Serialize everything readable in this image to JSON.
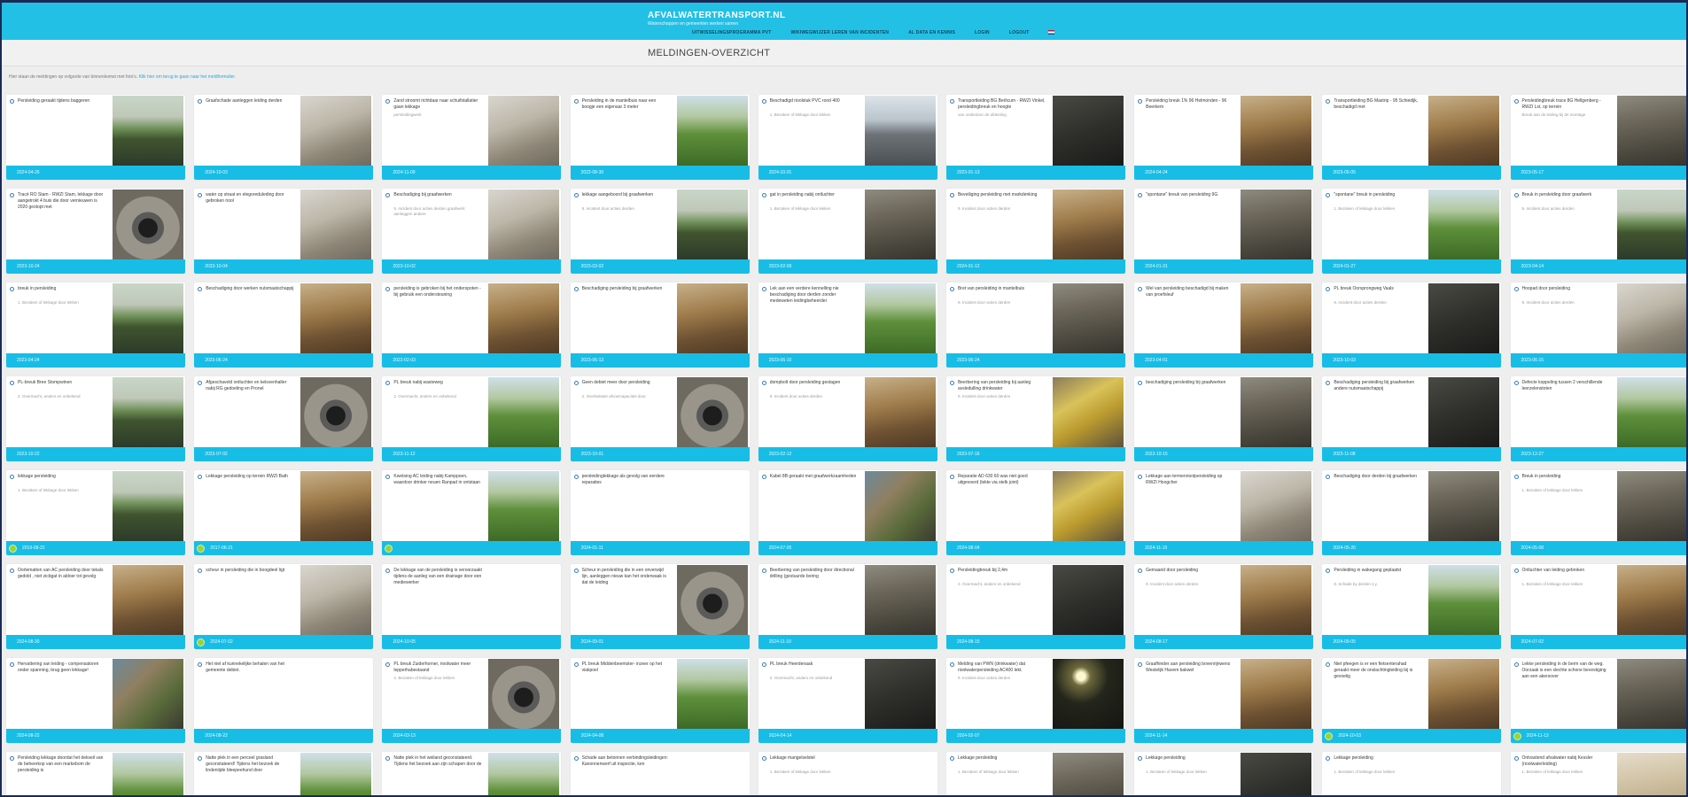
{
  "header": {
    "site_title": "AFVALWATERTRANSPORT.NL",
    "site_subtitle": "Waterschappen en gemeenten werken samen",
    "nav": [
      {
        "label": "UITWISSELINGSPROGRAMMA PVT"
      },
      {
        "label": "WIKIWEGWIJZER LEREN VAN INCIDENTEN"
      },
      {
        "label": "AL DATA EN KENNIS"
      },
      {
        "label": "LOGIN"
      },
      {
        "label": "LOGOUT"
      }
    ]
  },
  "page": {
    "title": "MELDINGEN-OVERZICHT",
    "intro_text": "Hier staan de meldingen op volgorde van binnenkomst met foto's.",
    "intro_link": "Klik hier om terug te gaan naar het meldformulier"
  },
  "cards": [
    {
      "title": "Persleiding geraakt tijdens baggeren",
      "desc": "",
      "date": "2024-04-26",
      "photo": "ph-water",
      "badge": false
    },
    {
      "title": "Graafschade aanleggen leiding derden",
      "desc": "",
      "date": "2024-10-03",
      "photo": "ph-concrete",
      "badge": false
    },
    {
      "title": "Zand stroomt richtdaar naar schuifstallatier gaan lekkage",
      "desc": "persleidingwerk",
      "date": "2024-11-09",
      "photo": "ph-concrete",
      "badge": false
    },
    {
      "title": "Persleiding in de mantelbuis naar een boogje een eigenaar 3 meter",
      "desc": "",
      "date": "2022-08-30",
      "photo": "ph-grass",
      "badge": false
    },
    {
      "title": "Beschadigd rioolstuk PVC rond 400",
      "desc": "1. Bezaken of lekkage door lekken",
      "date": "2024-10-01",
      "photo": "ph-road",
      "badge": false
    },
    {
      "title": "Transportleiding BG Berlicum - RWZI Vinkel, persleidingbreuk en hoogte",
      "desc": "van onderdoor de afdeeling",
      "date": "2023-01-13",
      "photo": "ph-dark",
      "badge": false
    },
    {
      "title": "Persleiding breuk 1% 96 Helmonden - 96 Beerkem",
      "desc": "",
      "date": "2024-04-24",
      "photo": "ph-ground",
      "badge": false
    },
    {
      "title": "Transportleiding BG Mastrip - 95 Schiedijk, beschadigd met",
      "desc": "",
      "date": "2023-05-05",
      "photo": "ph-ground",
      "badge": false
    },
    {
      "title": "Persleidingbreuk trace 8G Hellgenberg - RWZI Lst, op terrein",
      "desc": "Breuk aan de leiding bij de montage",
      "date": "2023-05-17",
      "photo": "ph-mud",
      "badge": false
    },
    {
      "title": "Tracé RO Stam - RWZI Stam, lekkage door aangetrokt 4 buis die door vernieuwen is 2020 gestopt met",
      "desc": "",
      "date": "2023-10-24",
      "photo": "ph-pipe",
      "badge": false
    },
    {
      "title": "water op straat en elegoreduleding door gebroken riool",
      "desc": "",
      "date": "2023-10-04",
      "photo": "ph-concrete",
      "badge": false
    },
    {
      "title": "Beschadiging bij graafwerken",
      "desc": "9. Incident door acties derden graafwerk aanleggen andere",
      "date": "2023-10-02",
      "photo": "ph-concrete",
      "badge": false
    },
    {
      "title": "lekkage aangeboord bij graafwerken",
      "desc": "9. Incident door acties derden",
      "date": "2023-03-02",
      "photo": "ph-water",
      "badge": false
    },
    {
      "title": "gat in persleiding nabij ontluchter",
      "desc": "1. Bezaken of lekkage door lekken",
      "date": "2023-02-09",
      "photo": "ph-mud",
      "badge": false
    },
    {
      "title": "Beveiliging persleiding met markdenking",
      "desc": "9. Incident door acties derden",
      "date": "2024-01-12",
      "photo": "ph-ground",
      "badge": false
    },
    {
      "title": "\"spontane\" breuk van persleiding 9G",
      "desc": "",
      "date": "2024-01-31",
      "photo": "ph-mud",
      "badge": false
    },
    {
      "title": "\"spontane\" breuk in persleiding",
      "desc": "1. Bezaken of lekkage door lekken",
      "date": "2024-01-27",
      "photo": "ph-grass",
      "badge": false
    },
    {
      "title": "Breuk in persleiding door graafwerk",
      "desc": "9. Incident door acties derden",
      "date": "2023-04-14",
      "photo": "ph-water",
      "badge": false
    },
    {
      "title": "breuk in persleiding",
      "desc": "1. Bezaken of lekkage door lekken",
      "date": "2023-04-24",
      "photo": "ph-water",
      "badge": false
    },
    {
      "title": "Beschadiging door werken nutsmaatschappij",
      "desc": "",
      "date": "2023-06-24",
      "photo": "ph-ground",
      "badge": false
    },
    {
      "title": "persleiding is gebroken bij het onderspoten - bij gebruik een ondersteuning",
      "desc": "",
      "date": "2022-02-03",
      "photo": "ph-ground",
      "badge": false
    },
    {
      "title": "Beschadiging persleiding bij graafwerken",
      "desc": "",
      "date": "2023-06-13",
      "photo": "ph-ground",
      "badge": false
    },
    {
      "title": "Lek aan een verdere kennelling nie beschadiging door derden zonder medeweten leidingbeheerder",
      "desc": "",
      "date": "2023-06-10",
      "photo": "ph-grass",
      "badge": false
    },
    {
      "title": "Bret van persleiding in mantelbuis",
      "desc": "9. Incident door acties derden",
      "date": "2023-06-24",
      "photo": "ph-mud",
      "badge": false
    },
    {
      "title": "Wel van persleiding beschadigd bij maken van proefsleuf",
      "desc": "",
      "date": "2023-04-01",
      "photo": "ph-ground",
      "badge": false
    },
    {
      "title": "PL breuk Oorsprongweg Vaals",
      "desc": "9. Incident door acties derden",
      "date": "2023-10-03",
      "photo": "ph-dark",
      "badge": false
    },
    {
      "title": "Hoopad door persleiding",
      "desc": "9. Incident door acties derden",
      "date": "2023-06-15",
      "photo": "ph-concrete",
      "badge": false
    },
    {
      "title": "PL-breuk Bree Stompwinen",
      "desc": "2. Overmacht, anders en onbekend",
      "date": "2023-10-22",
      "photo": "ph-water",
      "badge": false
    },
    {
      "title": "Afgeschaveld ontluchter en kelsvenhalter nabij RG gedoeling en Pronel",
      "desc": "",
      "date": "2023-07-02",
      "photo": "ph-pipe",
      "badge": false
    },
    {
      "title": "PL breuk nabij wasteweg",
      "desc": "2. Overmacht, anders en onbekend",
      "date": "2023-11-12",
      "photo": "ph-grass",
      "badge": false
    },
    {
      "title": "Geen debiet meer door persleiding",
      "desc": "2. Overbelaste afvoercapaciteit door",
      "date": "2023-10-01",
      "photo": "ph-pipe",
      "badge": false
    },
    {
      "title": "dompbolt door persleiding gestagen",
      "desc": "9. Incident door acties derden",
      "date": "2023-02-12",
      "photo": "ph-ground",
      "badge": false
    },
    {
      "title": "Beerbering van persleiding bij aanleg avsledulling drinkwater",
      "desc": "9. Incident door acties derden",
      "date": "2023-07-16",
      "photo": "ph-yellow",
      "badge": false
    },
    {
      "title": "beschadiging persleiding bij graafwerken",
      "desc": "",
      "date": "2023-10-15",
      "photo": "ph-mud",
      "badge": false
    },
    {
      "title": "Beschadiging persleiding bij graafwerken andere nutsmaatschappij",
      "desc": "",
      "date": "2023-11-08",
      "photo": "ph-dark",
      "badge": false
    },
    {
      "title": "Defecte koppeling tussen 2 verschillende leerzelenstoten",
      "desc": "",
      "date": "2023-12-27",
      "photo": "ph-grass",
      "badge": false
    },
    {
      "title": "lekkage persleiding",
      "desc": "1. Bezaken of lekkage door lekken",
      "date": "2019-08-22",
      "photo": "ph-water",
      "badge": true
    },
    {
      "title": "Lekkage persleiding op terrein RWZI Bath",
      "desc": "",
      "date": "2017-06-21",
      "photo": "ph-ground",
      "badge": true
    },
    {
      "title": "Kwetsing AC leiding nabij Kamppoen, waardoor drinker neuen Ranpad in ontstaan",
      "desc": "",
      "date": "",
      "photo": "ph-grass",
      "badge": true
    },
    {
      "title": "persleidinglekkage als gevolg van eerdere reparaties",
      "desc": "",
      "date": "2024-01-11",
      "photo": "",
      "badge": false
    },
    {
      "title": "Kabel 8B geraakt met graafwerkzaamheden",
      "desc": "",
      "date": "2024-07-05",
      "photo": "ph-mixed",
      "badge": false
    },
    {
      "title": "Reparatie AD 630 60 was niet goed uitgevoerd (lekte via stelk joint)",
      "desc": "",
      "date": "2024-08-04",
      "photo": "ph-yellow",
      "badge": false
    },
    {
      "title": "Lekkage aan termenrioolpersleiding op RWZI Hoogcher",
      "desc": "",
      "date": "2024-11-15",
      "photo": "ph-concrete",
      "badge": false
    },
    {
      "title": "Beschadiging door derden bij graafwerken",
      "desc": "",
      "date": "2024-05-26",
      "photo": "ph-mud",
      "badge": false
    },
    {
      "title": "Breuk in persleiding",
      "desc": "1. Bezaken of lekkage door lekken",
      "date": "2024-05-08",
      "photo": "ph-mud",
      "badge": false
    },
    {
      "title": "Oorlematten van AC persleiding door tekals gedold , niet zicbgat in aldoer tot gevolg",
      "desc": "",
      "date": "2024-08-30",
      "photo": "ph-ground",
      "badge": false
    },
    {
      "title": "scheur in persleiding die in boogdeel ligt",
      "desc": "",
      "date": "2024-07-02",
      "photo": "ph-concrete",
      "badge": true
    },
    {
      "title": "De lekkage van de persleiding is veroorzaakt tijdens de aanleg van een drainage door een mediewerker",
      "desc": "",
      "date": "2024-10-05",
      "photo": "",
      "badge": false
    },
    {
      "title": "Scheur in persleiding die in een onverwijd lijn, aanleggen nieuw kan het onderwaak is dat de leiding",
      "desc": "",
      "date": "2024-09-01",
      "photo": "ph-pipe",
      "badge": false
    },
    {
      "title": "Beerbering van persleiding door directional drilling (gestuurde boring",
      "desc": "",
      "date": "2024-11-10",
      "photo": "ph-mud",
      "badge": false
    },
    {
      "title": "Persleidingbreuk bij 2,4m",
      "desc": "2. Overmacht, anders en onbekend",
      "date": "2024-08-15",
      "photo": "ph-dark",
      "badge": false
    },
    {
      "title": "Gemaand door persleiding",
      "desc": "9. Incident door acties derden",
      "date": "2024-08-17",
      "photo": "ph-ground",
      "badge": false
    },
    {
      "title": "Persleiding in wakegang geplaatst",
      "desc": "8. Schade by derden s.y.",
      "date": "2024-09-05",
      "photo": "ph-grass",
      "badge": false
    },
    {
      "title": "Ontluchter van leiding gebroken",
      "desc": "1. Bezaken of lekkage door lekken",
      "date": "2024-07-02",
      "photo": "ph-ground",
      "badge": false
    },
    {
      "title": "Hervattering van leiding - compensatoren onder spanning, brug geen lekkage!",
      "desc": "",
      "date": "2024-08-22",
      "photo": "ph-mixed",
      "badge": false
    },
    {
      "title": "Het niet af kunnekelijke behalen van het gemeente debiet.",
      "desc": "",
      "date": "2024-08-22",
      "photo": "",
      "badge": false
    },
    {
      "title": "PL breuk Zuiderhorner, rioolwater meer lepperhabestaand",
      "desc": "2. Bezaken of lekkage door lekken",
      "date": "2024-03-13",
      "photo": "ph-pipe",
      "badge": false
    },
    {
      "title": "PL breuk Middenbeemster- inzeer op het viakpoel",
      "desc": "",
      "date": "2024-04-08",
      "photo": "ph-grass",
      "badge": false
    },
    {
      "title": "PL breuk Heerdenaak",
      "desc": "2. Overmacht, anders en onbekend",
      "date": "2024-04-14",
      "photo": "ph-dark",
      "badge": false
    },
    {
      "title": "Melding van PWN (drinkwater) dat rioolwaterpersleiding AC400 lekt.",
      "desc": "9. Incident door acties derden",
      "date": "2024-02-07",
      "photo": "ph-night",
      "badge": false
    },
    {
      "title": "Graafhinder aan persleiding bovenrijnwens Westelijk Havem bakwel",
      "desc": "",
      "date": "2024-11-14",
      "photo": "ph-ground",
      "badge": false
    },
    {
      "title": "Niet pfeegen is er een fietsenterahad geraakt meer de onslachtingleiding bij is gevoelig",
      "desc": "",
      "date": "2024-10-03",
      "photo": "ph-ground",
      "badge": true
    },
    {
      "title": "Lekke persleiding in de berm van de weg. Oorzaak is een slechte schone bevestiging aan een akersover",
      "desc": "",
      "date": "2024-11-13",
      "photo": "ph-mud",
      "badge": true
    },
    {
      "title": "Persleiding lekkage doordat het dekseil van de beheerkop van een markebom de persleiding is",
      "desc": "",
      "date": "",
      "photo": "ph-grass",
      "badge": false
    },
    {
      "title": "Natte plek in een perceel grasland geconstateerd! Tijdens het bezoek de lindeniijde bleepeehund door",
      "desc": "",
      "date": "",
      "photo": "ph-grass",
      "badge": false
    },
    {
      "title": "Natte plek in het weiland geconstateerd. Tijdens het bezoek aan zijn schapen door de",
      "desc": "",
      "date": "",
      "photo": "ph-grass",
      "badge": false
    },
    {
      "title": "Schade aan betonnen verbindingsleidingen: Kanonnenwerf uit inspectie, ken",
      "desc": "",
      "date": "",
      "photo": "",
      "badge": false
    },
    {
      "title": "Lekkage mangelselstel",
      "desc": "1. Bezaken of lekkage door lekken",
      "date": "",
      "photo": "",
      "badge": false
    },
    {
      "title": "Lekkage persleiding",
      "desc": "1. Bezaken of lekkage door lekken",
      "date": "",
      "photo": "ph-mud",
      "badge": false
    },
    {
      "title": "Lekkage persleiding",
      "desc": "1. Bezaken of lekkage door lekken",
      "date": "",
      "photo": "ph-dark",
      "badge": false
    },
    {
      "title": "Lekkage persleiding",
      "desc": "1. Bezaken of lekkage door lekken",
      "date": "",
      "photo": "",
      "badge": false
    },
    {
      "title": "Ontvastend afvalwater nabij Kessler (rioolwaterleiding)",
      "desc": "1. Bezaken of lekkage door lekken",
      "date": "",
      "photo": "ph-sand",
      "badge": false
    }
  ]
}
